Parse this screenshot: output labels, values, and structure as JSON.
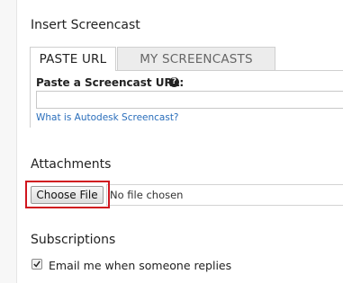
{
  "screencast": {
    "title": "Insert Screencast",
    "tabs": [
      {
        "label": "PASTE URL",
        "active": true
      },
      {
        "label": "MY SCREENCASTS",
        "active": false
      }
    ],
    "url_label": "Paste a Screencast URL:",
    "url_value": "",
    "help_link": "What is Autodesk Screencast?"
  },
  "attachments": {
    "title": "Attachments",
    "choose_label": "Choose File",
    "status": "No file chosen",
    "highlight_color": "#d0151f"
  },
  "subscriptions": {
    "title": "Subscriptions",
    "email_label": "Email me when someone replies",
    "email_checked": true
  }
}
